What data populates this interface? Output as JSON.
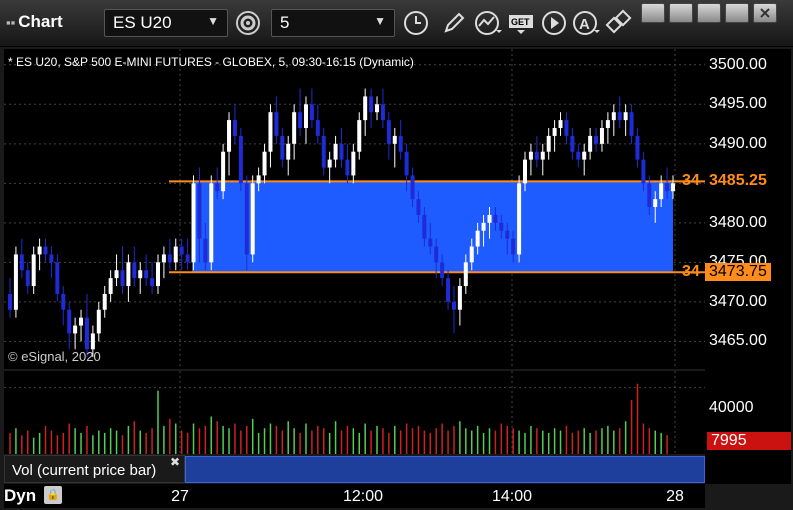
{
  "window": {
    "title": "Chart"
  },
  "toolbar": {
    "symbol": "ES U20",
    "interval": "5"
  },
  "chart": {
    "info": "* ES U20, S&P 500 E-MINI FUTURES - GLOBEX, 5, 09:30-16:15 (Dynamic)",
    "copyright": "© eSignal, 2020",
    "price_labels": [
      "3500.00",
      "3495.00",
      "3490.00",
      "3485.00",
      "3480.00",
      "3475.00",
      "3470.00",
      "3465.00"
    ],
    "upper_level": {
      "value": "3485.25",
      "side": "34"
    },
    "lower_level": {
      "value": "3473.75",
      "side": "34"
    },
    "volume_label": "40000",
    "volume_value": "7995",
    "time_labels": [
      "27",
      "12:00",
      "14:00",
      "28"
    ],
    "colors": {
      "band": "#1f5cff",
      "level": "#ff8c1a",
      "up": "#ffffff",
      "down": "#1e2bd6",
      "vol_up": "#55cc55",
      "vol_down": "#cc2222",
      "vol_tag": "#cc1111"
    }
  },
  "chart_data": {
    "type": "candlestick",
    "ylim": [
      3461.5,
      3502
    ],
    "ohlc": [
      [
        3471,
        3473,
        3468,
        3469
      ],
      [
        3469,
        3477,
        3468,
        3476
      ],
      [
        3476,
        3478,
        3473,
        3474
      ],
      [
        3474,
        3475,
        3471,
        3472
      ],
      [
        3472,
        3477,
        3471,
        3476
      ],
      [
        3476,
        3478,
        3474,
        3477
      ],
      [
        3477,
        3478,
        3475,
        3476
      ],
      [
        3476,
        3477,
        3473,
        3475
      ],
      [
        3475,
        3476,
        3470,
        3471
      ],
      [
        3471,
        3472,
        3467,
        3469
      ],
      [
        3469,
        3470,
        3464,
        3466
      ],
      [
        3466,
        3468,
        3464,
        3467
      ],
      [
        3467,
        3469,
        3465,
        3468
      ],
      [
        3468,
        3471,
        3463,
        3464
      ],
      [
        3464,
        3467,
        3463,
        3466
      ],
      [
        3466,
        3470,
        3465,
        3469
      ],
      [
        3469,
        3472,
        3468,
        3471
      ],
      [
        3471,
        3474,
        3470,
        3473
      ],
      [
        3473,
        3476,
        3472,
        3474
      ],
      [
        3474,
        3477,
        3471,
        3472
      ],
      [
        3472,
        3476,
        3470,
        3475
      ],
      [
        3475,
        3477,
        3472,
        3473
      ],
      [
        3473,
        3475,
        3471,
        3474
      ],
      [
        3474,
        3476,
        3472,
        3473
      ],
      [
        3473,
        3475,
        3471,
        3472
      ],
      [
        3472,
        3476,
        3471,
        3475
      ],
      [
        3475,
        3477,
        3473,
        3476
      ],
      [
        3476,
        3478,
        3474,
        3475
      ],
      [
        3475,
        3478,
        3474,
        3477
      ],
      [
        3477,
        3478,
        3474,
        3476
      ],
      [
        3476,
        3478,
        3474,
        3475
      ],
      [
        3475,
        3486,
        3474,
        3485
      ],
      [
        3485,
        3487,
        3475,
        3478
      ],
      [
        3478,
        3480,
        3474,
        3475
      ],
      [
        3475,
        3486,
        3474,
        3485
      ],
      [
        3485,
        3487,
        3483,
        3484
      ],
      [
        3484,
        3490,
        3483,
        3489
      ],
      [
        3489,
        3494,
        3486,
        3493
      ],
      [
        3493,
        3495,
        3490,
        3491
      ],
      [
        3491,
        3492,
        3484,
        3485
      ],
      [
        3485,
        3486,
        3474,
        3476
      ],
      [
        3476,
        3486,
        3475,
        3485
      ],
      [
        3485,
        3487,
        3484,
        3486
      ],
      [
        3486,
        3490,
        3485,
        3489
      ],
      [
        3489,
        3495,
        3487,
        3494
      ],
      [
        3494,
        3496,
        3490,
        3491
      ],
      [
        3491,
        3492,
        3487,
        3488
      ],
      [
        3488,
        3491,
        3486,
        3490
      ],
      [
        3490,
        3495,
        3488,
        3494
      ],
      [
        3494,
        3497,
        3491,
        3492
      ],
      [
        3492,
        3496,
        3490,
        3495
      ],
      [
        3495,
        3497,
        3492,
        3493
      ],
      [
        3493,
        3495,
        3490,
        3491
      ],
      [
        3491,
        3492,
        3486,
        3487
      ],
      [
        3487,
        3489,
        3485,
        3488
      ],
      [
        3488,
        3491,
        3487,
        3490
      ],
      [
        3490,
        3492,
        3487,
        3488
      ],
      [
        3488,
        3490,
        3485,
        3486
      ],
      [
        3486,
        3490,
        3485,
        3489
      ],
      [
        3489,
        3494,
        3488,
        3493
      ],
      [
        3493,
        3497,
        3491,
        3496
      ],
      [
        3496,
        3497,
        3492,
        3494
      ],
      [
        3494,
        3496,
        3493,
        3495
      ],
      [
        3495,
        3497,
        3492,
        3493
      ],
      [
        3493,
        3494,
        3488,
        3490
      ],
      [
        3490,
        3492,
        3487,
        3491
      ],
      [
        3491,
        3493,
        3488,
        3489
      ],
      [
        3489,
        3490,
        3484,
        3486
      ],
      [
        3486,
        3487,
        3482,
        3483
      ],
      [
        3483,
        3484,
        3480,
        3481
      ],
      [
        3481,
        3482,
        3477,
        3478
      ],
      [
        3478,
        3480,
        3476,
        3477
      ],
      [
        3477,
        3478,
        3473,
        3475
      ],
      [
        3475,
        3476,
        3472,
        3473
      ],
      [
        3473,
        3474,
        3469,
        3470
      ],
      [
        3470,
        3472,
        3466,
        3469
      ],
      [
        3469,
        3473,
        3467,
        3472
      ],
      [
        3472,
        3476,
        3471,
        3475
      ],
      [
        3475,
        3478,
        3474,
        3477
      ],
      [
        3477,
        3480,
        3476,
        3479
      ],
      [
        3479,
        3481,
        3477,
        3480
      ],
      [
        3480,
        3482,
        3478,
        3481
      ],
      [
        3481,
        3482,
        3479,
        3480
      ],
      [
        3480,
        3481,
        3478,
        3479
      ],
      [
        3479,
        3480,
        3476,
        3478
      ],
      [
        3478,
        3479,
        3475,
        3476
      ],
      [
        3476,
        3486,
        3475,
        3485
      ],
      [
        3485,
        3489,
        3484,
        3488
      ],
      [
        3488,
        3490,
        3486,
        3489
      ],
      [
        3489,
        3491,
        3487,
        3488
      ],
      [
        3488,
        3490,
        3486,
        3489
      ],
      [
        3489,
        3492,
        3488,
        3491
      ],
      [
        3491,
        3493,
        3489,
        3492
      ],
      [
        3492,
        3494,
        3491,
        3493
      ],
      [
        3493,
        3494,
        3490,
        3491
      ],
      [
        3491,
        3492,
        3488,
        3489
      ],
      [
        3489,
        3490,
        3487,
        3488
      ],
      [
        3488,
        3490,
        3486,
        3489
      ],
      [
        3489,
        3492,
        3488,
        3491
      ],
      [
        3491,
        3492,
        3489,
        3490
      ],
      [
        3490,
        3493,
        3489,
        3492
      ],
      [
        3492,
        3494,
        3490,
        3493
      ],
      [
        3493,
        3495,
        3491,
        3494
      ],
      [
        3494,
        3496,
        3492,
        3493
      ],
      [
        3493,
        3495,
        3491,
        3494
      ],
      [
        3494,
        3495,
        3490,
        3491
      ],
      [
        3491,
        3492,
        3487,
        3488
      ],
      [
        3488,
        3489,
        3484,
        3485
      ],
      [
        3485,
        3486,
        3481,
        3482
      ],
      [
        3482,
        3484,
        3480,
        3483
      ],
      [
        3483,
        3486,
        3482,
        3485
      ],
      [
        3485,
        3487,
        3483,
        3484
      ],
      [
        3484,
        3486,
        3483,
        3485
      ]
    ],
    "volume": [
      9000,
      11000,
      8000,
      10000,
      7000,
      9000,
      12000,
      10000,
      8000,
      9000,
      13000,
      11000,
      9000,
      12000,
      8000,
      10000,
      9000,
      11000,
      10000,
      8000,
      12000,
      14000,
      10000,
      9000,
      11000,
      27000,
      12000,
      15000,
      13000,
      10000,
      9000,
      13000,
      11000,
      12000,
      16000,
      14000,
      12000,
      11000,
      13000,
      10000,
      12000,
      15000,
      9000,
      11000,
      13000,
      12000,
      10000,
      14000,
      11000,
      9000,
      13000,
      10000,
      12000,
      11000,
      9000,
      14000,
      10000,
      12000,
      11000,
      9000,
      13000,
      10000,
      12000,
      11000,
      9000,
      12000,
      10000,
      13000,
      11000,
      12000,
      10000,
      9000,
      11000,
      13000,
      10000,
      12000,
      14000,
      11000,
      10000,
      12000,
      9000,
      11000,
      10000,
      13000,
      12000,
      11000,
      10000,
      9000,
      12000,
      11000,
      10000,
      9000,
      11000,
      10000,
      12000,
      9000,
      10000,
      11000,
      9000,
      10000,
      11000,
      12000,
      10000,
      11000,
      14000,
      23000,
      30000,
      13000,
      11000,
      10000,
      9000,
      8000
    ]
  }
}
